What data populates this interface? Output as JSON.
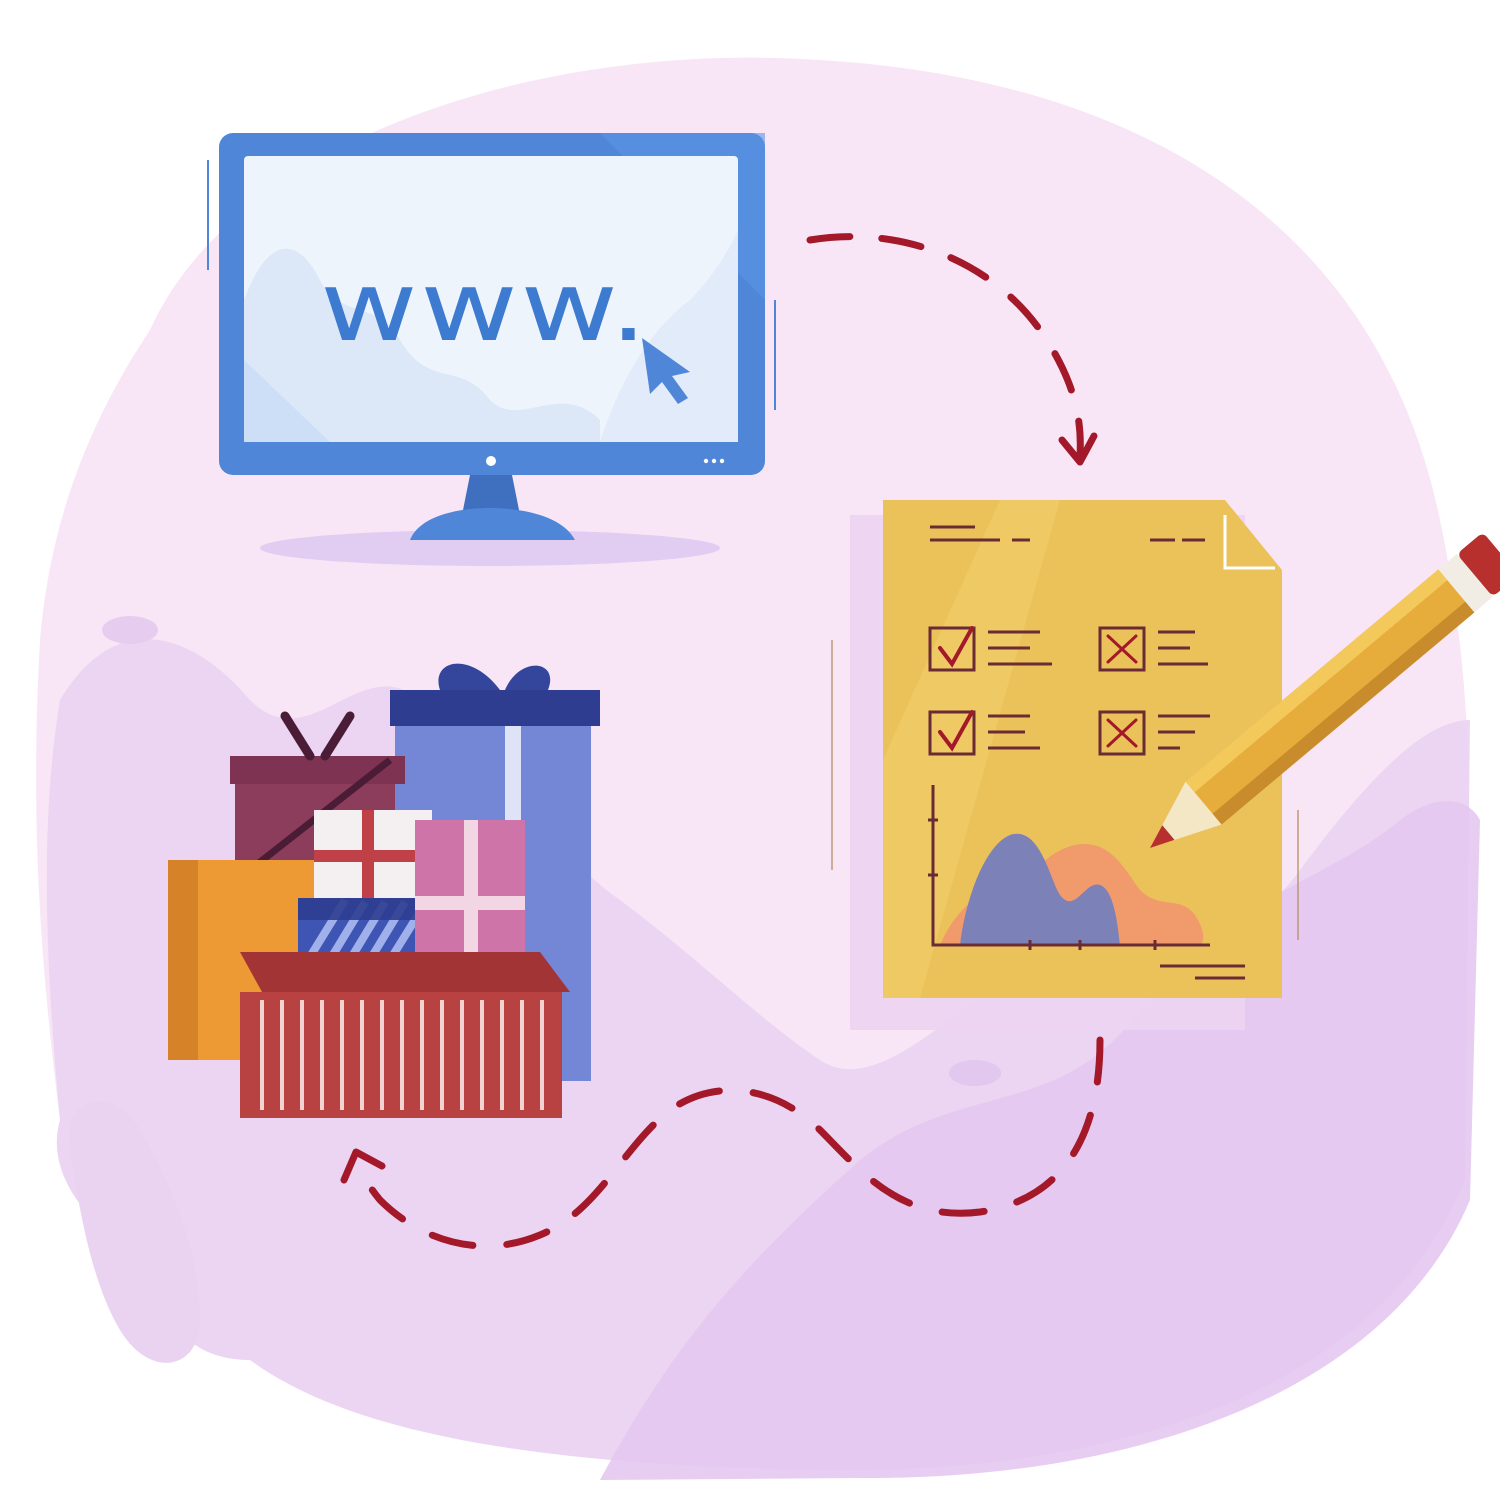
{
  "illustration": {
    "monitor_screen_text": "www.",
    "colors": {
      "background_blob": "#f6e6f6",
      "hills": "#e3c9ee",
      "monitor_frame": "#4f86d8",
      "monitor_screen": "#eef4fc",
      "www_text": "#3d7bd0",
      "dashed_path": "#a3192a",
      "document": "#ebc25a",
      "pencil_body": "#e6ad3c",
      "pencil_tip": "#b7302e",
      "chart_orange": "#f19a6c",
      "chart_blue": "#7c82b8",
      "gift_purple": "#7487d6",
      "gift_maroon": "#8c3d5c",
      "gift_orange": "#ee9a34",
      "gift_pink": "#cf74a8",
      "gift_red": "#b84141"
    },
    "icons": [
      "monitor-icon",
      "cursor-arrow-icon",
      "document-icon",
      "pencil-icon",
      "checkbox-check-icon",
      "checkbox-cross-icon",
      "gift-boxes-icon",
      "dashed-arrow-icon"
    ]
  }
}
